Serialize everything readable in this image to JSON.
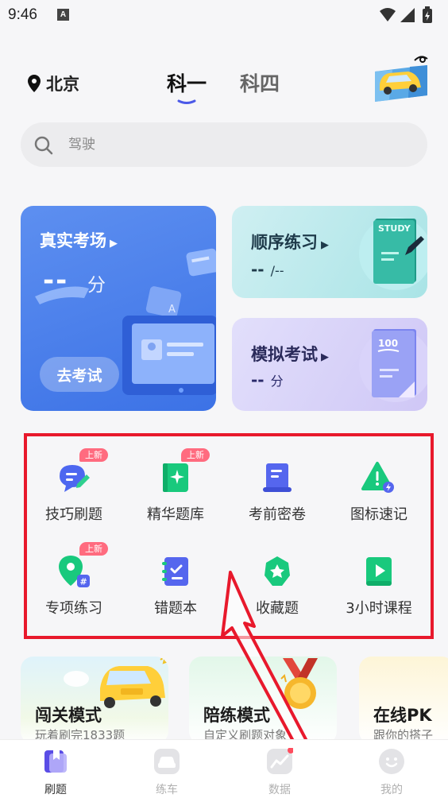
{
  "status_bar": {
    "time": "9:46",
    "sim_icon_letter": "A",
    "icons": [
      "wifi-icon",
      "cell-signal-icon",
      "battery-charging-icon"
    ]
  },
  "header": {
    "location": "北京",
    "tabs": [
      {
        "label": "科一",
        "active": true
      },
      {
        "label": "科四",
        "active": false
      }
    ]
  },
  "search": {
    "placeholder": "驾驶"
  },
  "cards": {
    "real_exam": {
      "title": "真实考场",
      "score": "--",
      "unit": "分",
      "button": "去考试"
    },
    "sequential": {
      "title": "顺序练习",
      "value": "--",
      "sub": "/--",
      "art_text": "STUDY"
    },
    "mock_exam": {
      "title": "模拟考试",
      "value": "--",
      "unit": "分",
      "art_text": "100"
    }
  },
  "shortcuts": [
    {
      "label": "技巧刷题",
      "badge": "上新",
      "icon": "chat-bubble-pen-icon"
    },
    {
      "label": "精华题库",
      "badge": "上新",
      "icon": "book-sparkle-icon"
    },
    {
      "label": "考前密卷",
      "badge": "",
      "icon": "scroll-document-icon"
    },
    {
      "label": "图标速记",
      "badge": "",
      "icon": "warning-sign-icon"
    },
    {
      "label": "专项练习",
      "badge": "上新",
      "icon": "location-pin-icon"
    },
    {
      "label": "错题本",
      "badge": "",
      "icon": "checklist-notebook-icon"
    },
    {
      "label": "收藏题",
      "badge": "",
      "icon": "star-badge-icon"
    },
    {
      "label": "3小时课程",
      "badge": "",
      "icon": "play-video-icon"
    }
  ],
  "modes": [
    {
      "name": "闯关模式",
      "desc": "玩着刷完1833题"
    },
    {
      "name": "陪练模式",
      "desc": "自定义刷题对象"
    },
    {
      "name": "在线PK",
      "desc": "跟你的搭子"
    }
  ],
  "bottom_nav": [
    {
      "label": "刷题",
      "active": true,
      "icon": "bookmark-book-icon"
    },
    {
      "label": "练车",
      "active": false,
      "icon": "car-icon"
    },
    {
      "label": "数据",
      "active": false,
      "icon": "chart-line-icon"
    },
    {
      "label": "我的",
      "active": false,
      "icon": "smiley-face-icon"
    }
  ],
  "colors": {
    "accent_blue": "#4b80ee",
    "highlight_red": "#e8192c",
    "new_badge": "#ff6b7f",
    "green_icon": "#19c97d",
    "purple_icon": "#4f5fe6"
  }
}
